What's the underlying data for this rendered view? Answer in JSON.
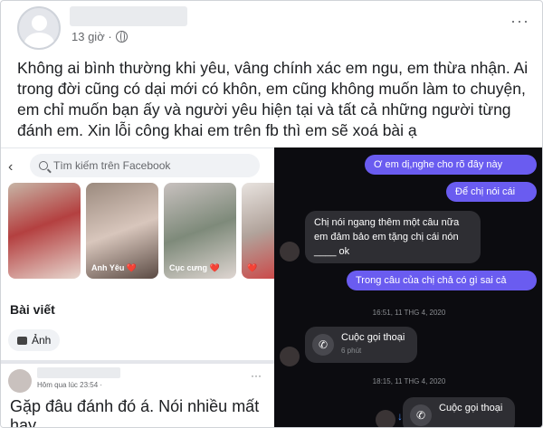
{
  "post": {
    "time": "13 giờ ·",
    "caption": "Không ai bình thường khi yêu, vâng chính xác em ngu, em thừa nhận. Ai trong đời cũng có dại mới có khôn, em cũng không muốn làm to chuyện, em chỉ muốn bạn ấy và người yêu hiện tại và tất cả những người từng đánh em. Xin lỗi công khai em trên fb thì em sẽ xoá bài ạ"
  },
  "left_shot": {
    "search_placeholder": "Tìm kiếm trên Facebook",
    "stories": [
      "",
      "Anh Yêu ❤️",
      "Cục cưng ❤️",
      "❤️"
    ],
    "section_title": "Bài viết",
    "photo_button": "Ảnh",
    "comment_time": "Hôm qua lúc 23:54 ·",
    "comment_text": "Gặp đâu đánh đó á. Nói nhiều mất hay"
  },
  "chat": {
    "messages": [
      "Ơ em dị,nghe cho rõ đây này",
      "Để chị nói cái",
      "Chị nói ngang thêm một câu nữa em đảm bảo em tặng chị cái nón ____ ok",
      "Trong câu của chị chả có gì sai cả"
    ],
    "timestamp1": "16:51, 11 THG 4, 2020",
    "timestamp2": "18:15, 11 THG 4, 2020",
    "call_title": "Cuộc gọi thoại",
    "call_sub": "6 phút",
    "call2_title": "Cuộc gọi thoại"
  }
}
